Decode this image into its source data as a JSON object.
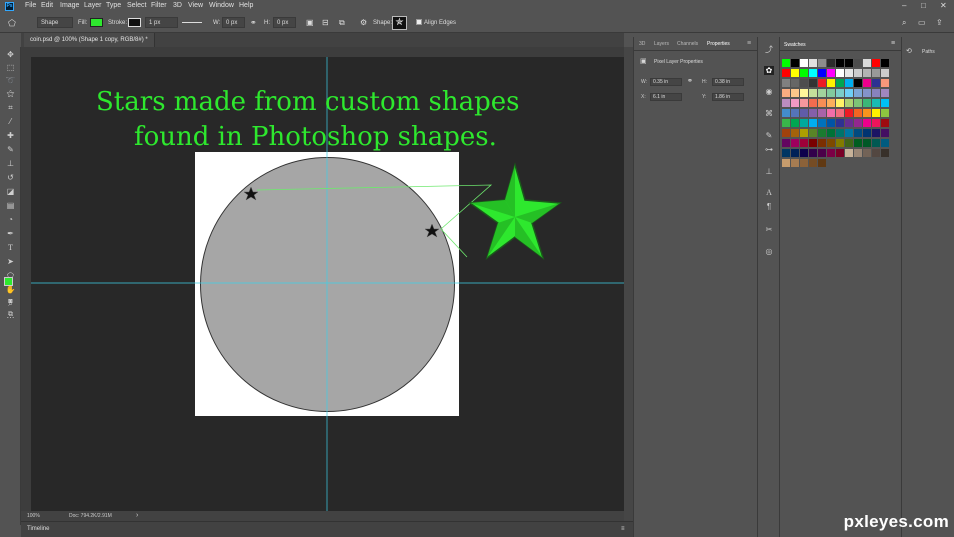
{
  "menu": {
    "logo": "Ps",
    "items": [
      "File",
      "Edit",
      "Image",
      "Layer",
      "Type",
      "Select",
      "Filter",
      "3D",
      "View",
      "Window",
      "Help"
    ],
    "window_controls": [
      "–",
      "□",
      "✕"
    ]
  },
  "options": {
    "mode": "Shape",
    "fill_label": "Fill:",
    "stroke_label": "Stroke:",
    "stroke_width": "1 px",
    "w_label": "W:",
    "w_value": "0 px",
    "h_label": "H:",
    "h_value": "0 px",
    "shape_label": "Shape:",
    "align_edges": "Align Edges",
    "fill_color": "#2ee82e"
  },
  "document": {
    "tab_title": "coin.psd @ 100% (Shape 1 copy, RGB/8#) *",
    "line1": "Stars made from custom shapes",
    "line2": "found in Photoshop shapes.",
    "text_color": "#2ee82e",
    "zoom": "100%",
    "doc_info": "Doc: 794.2K/2.91M"
  },
  "timeline": {
    "label": "Timeline"
  },
  "properties": {
    "tabs": [
      "3D",
      "Layers",
      "Channels",
      "Properties"
    ],
    "title": "Pixel Layer Properties",
    "w_label": "W:",
    "w_value": "0.35 in",
    "h_label": "H:",
    "h_value": "0.38 in",
    "x_label": "X:",
    "x_value": "6.1 in",
    "y_label": "Y:",
    "y_value": "1.86 in"
  },
  "swatches": {
    "title": "Swatches",
    "colors": [
      "#00ff00",
      "#000000",
      "#ffffff",
      "#e0e0e0",
      "#8c8c8c",
      "#2b2b2b",
      "#000000",
      "#000000",
      "#4d4d4d",
      "#d9d9d9",
      "#ff0000",
      "#000000",
      "#ff0000",
      "#ffff00",
      "#00ff00",
      "#00ffff",
      "#0000ff",
      "#ff00ff",
      "#ffffff",
      "#e6e6e6",
      "#cccccc",
      "#b3b3b3",
      "#999999",
      "#cccccc",
      "#808080",
      "#666666",
      "#4d4d4d",
      "#333333",
      "#ed1c24",
      "#fff200",
      "#00a651",
      "#00aeef",
      "#000000",
      "#ec008c",
      "#2e3192",
      "#f7977a",
      "#f9ad81",
      "#fdc68a",
      "#fff79a",
      "#c4df9b",
      "#a2d39c",
      "#82ca9d",
      "#7bcdc8",
      "#6ecff6",
      "#7ea7d8",
      "#8493ca",
      "#8882be",
      "#a187be",
      "#bc8dbf",
      "#f49ac2",
      "#f6989d",
      "#f26c4f",
      "#f68e55",
      "#fbaf5c",
      "#fff467",
      "#acd372",
      "#7cc576",
      "#3bb878",
      "#1abbb4",
      "#00bff3",
      "#438ccb",
      "#5574b9",
      "#605ca8",
      "#855fa8",
      "#a763a8",
      "#f06ea9",
      "#f26d7d",
      "#ed1c24",
      "#f26522",
      "#f7941d",
      "#fff200",
      "#8dc73f",
      "#39b54a",
      "#00a651",
      "#00a99d",
      "#00aeef",
      "#0072bc",
      "#0054a6",
      "#2e3192",
      "#662d91",
      "#92278f",
      "#ec008c",
      "#ed145b",
      "#9e0b0f",
      "#a0410d",
      "#a3620a",
      "#aba000",
      "#598527",
      "#1a7b30",
      "#007236",
      "#00746b",
      "#0076a3",
      "#004b80",
      "#003471",
      "#1b1464",
      "#440e62",
      "#630460",
      "#9e005d",
      "#9e0039",
      "#790000",
      "#7b2e00",
      "#7d4900",
      "#827b00",
      "#406618",
      "#005e20",
      "#005826",
      "#005952",
      "#005b7f",
      "#003663",
      "#002157",
      "#0d004c",
      "#32004b",
      "#4b0049",
      "#7b0046",
      "#7a0026",
      "#c7b299",
      "#998675",
      "#736357",
      "#534741",
      "#37302a",
      "#c69c6d",
      "#a67c52",
      "#8c6239",
      "#754c24",
      "#603913"
    ]
  },
  "paths": {
    "title": "Paths"
  },
  "watermark": "pxleyes.com",
  "icons": {
    "ps-logo": "ps-logo",
    "tools": [
      "move-icon",
      "marquee-icon",
      "lasso-icon",
      "magic-wand-icon",
      "crop-icon",
      "eyedropper-icon",
      "healing-brush-icon",
      "brush-icon",
      "clone-stamp-icon",
      "history-brush-icon",
      "eraser-icon",
      "gradient-icon",
      "blur-icon",
      "dodge-icon",
      "pen-icon",
      "type-icon",
      "path-select-icon",
      "shape-icon",
      "hand-icon",
      "zoom-icon",
      "more-tools-icon"
    ]
  }
}
